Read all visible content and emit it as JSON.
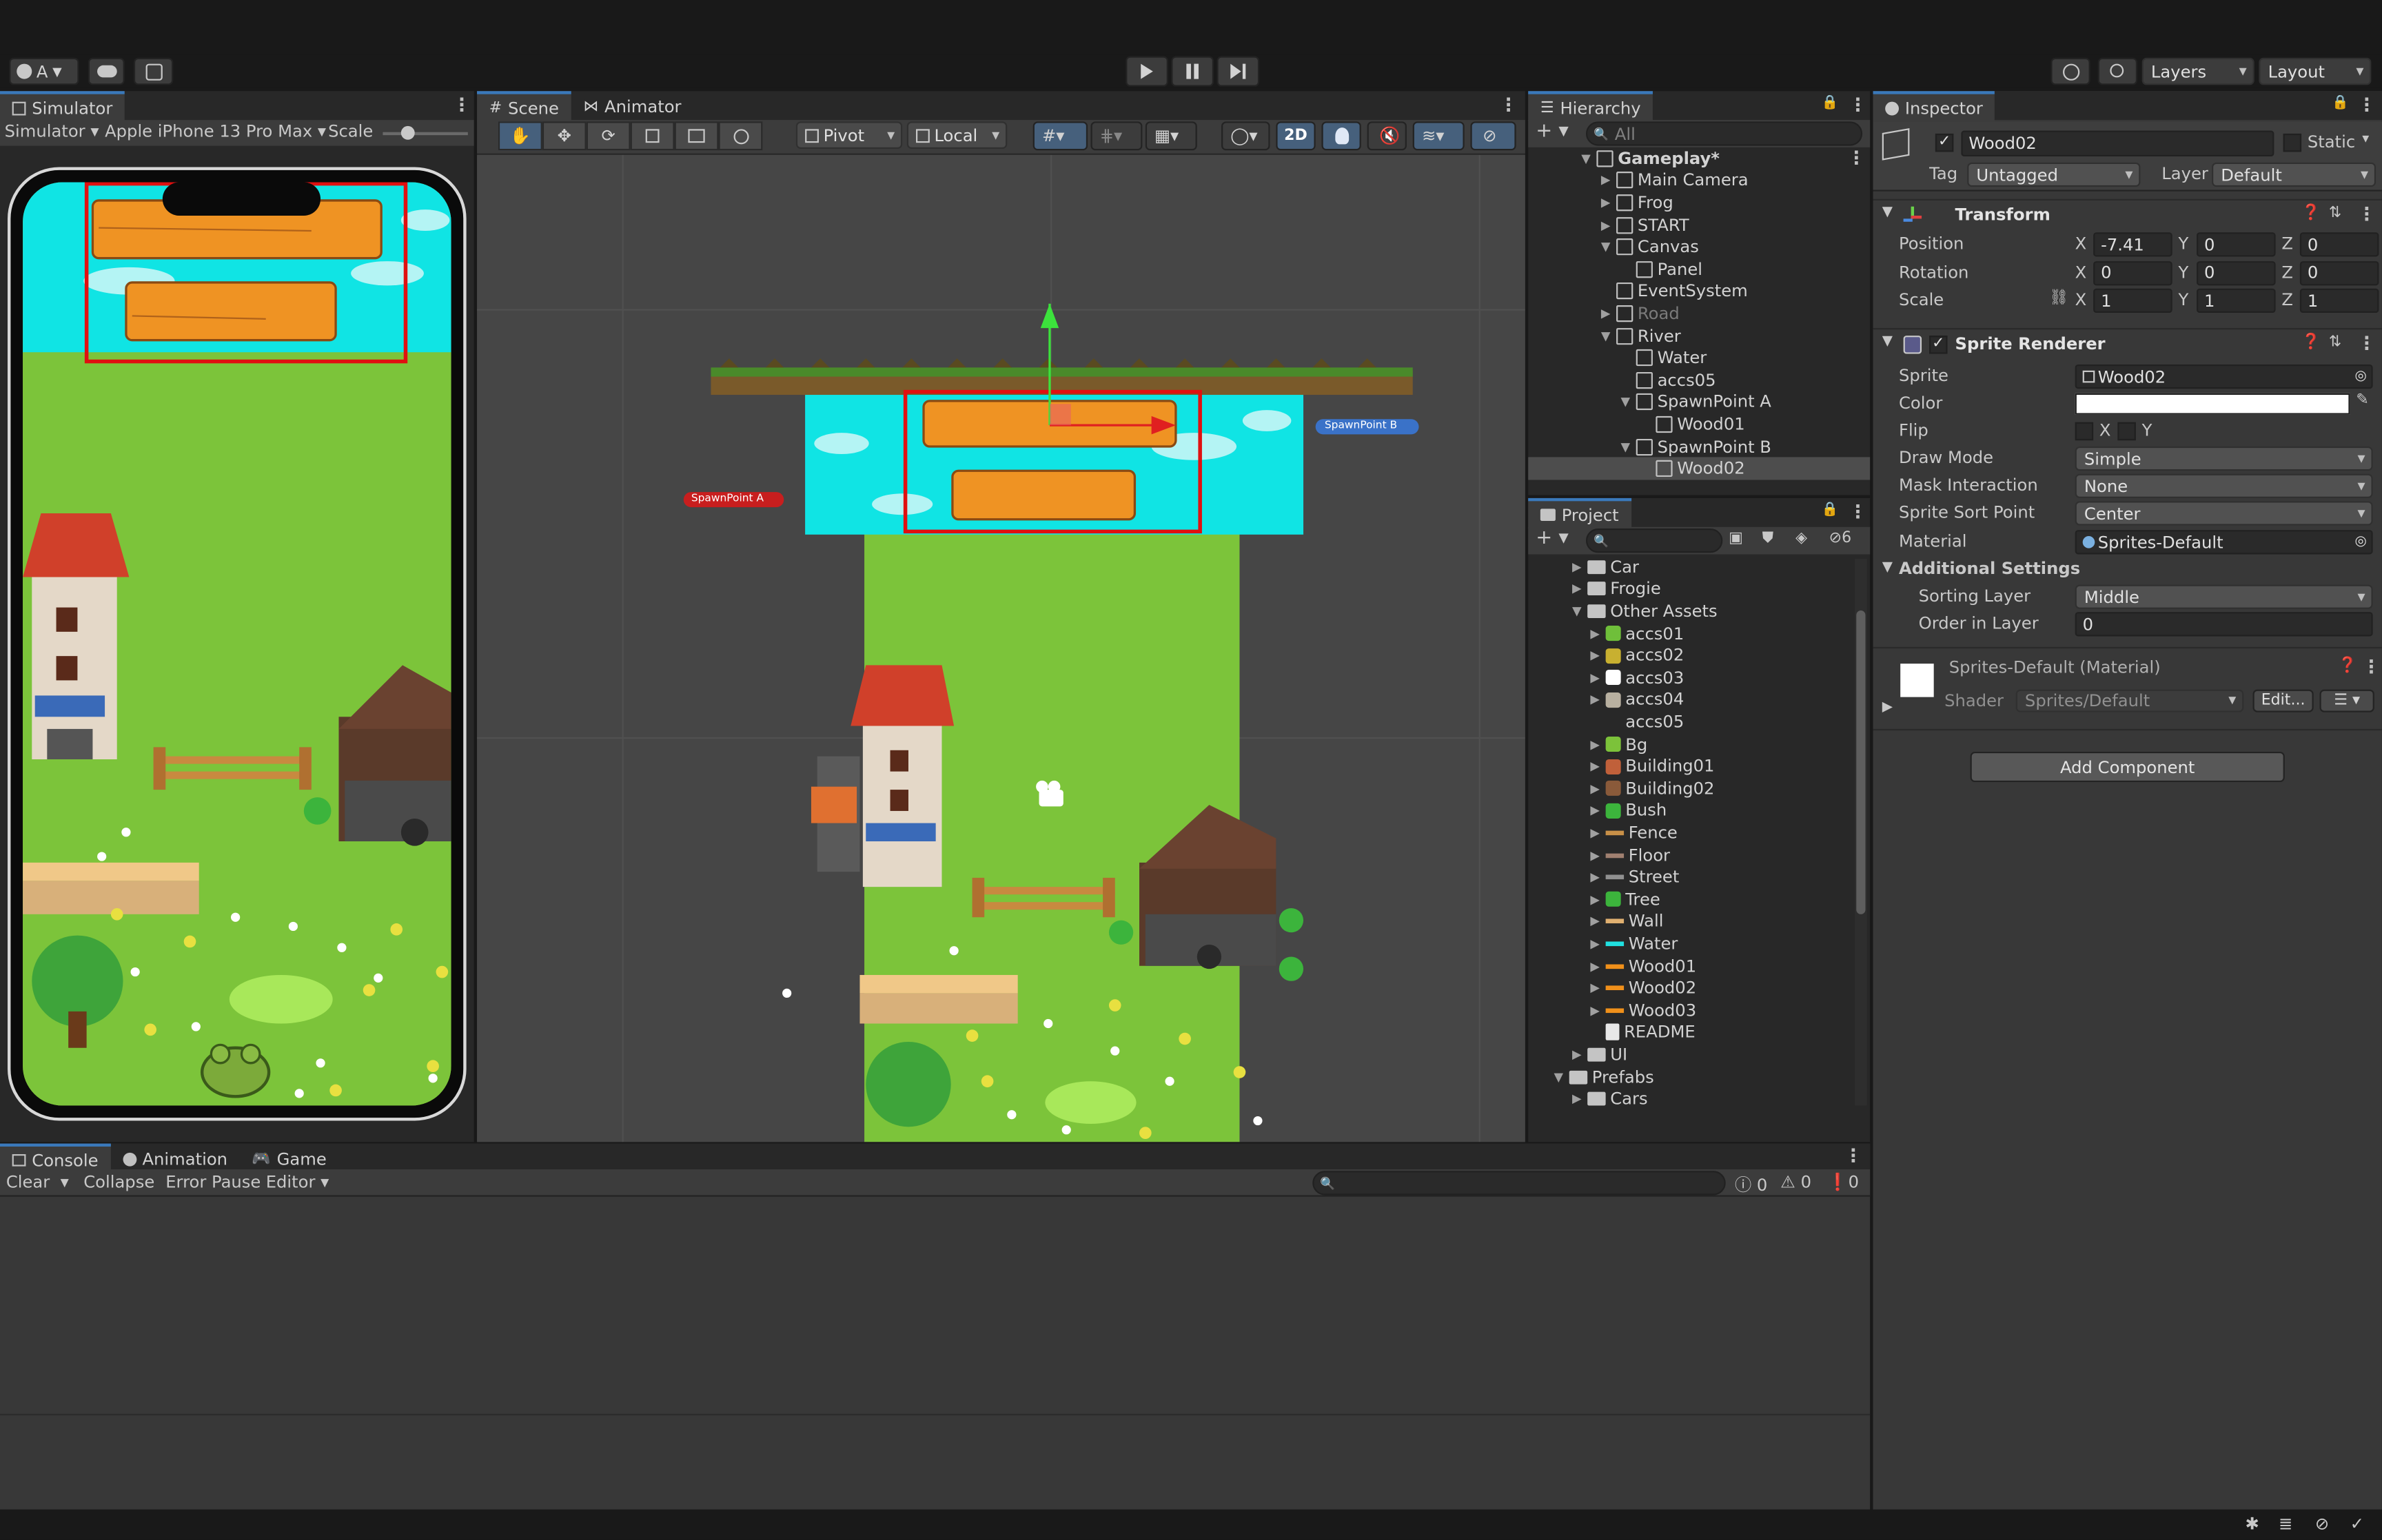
{
  "toolbar": {
    "account": "A",
    "layers": "Layers",
    "layout": "Layout"
  },
  "simulator": {
    "tab": "Simulator",
    "mode": "Simulator",
    "device": "Apple iPhone 13 Pro Max",
    "scale_label": "Scale"
  },
  "scene": {
    "tab_scene": "Scene",
    "tab_animator": "Animator",
    "pivot": "Pivot",
    "local": "Local",
    "mode_2d": "2D",
    "spawn_a": "SpawnPoint A",
    "spawn_b": "SpawnPoint B"
  },
  "hierarchy": {
    "title": "Hierarchy",
    "search": "All",
    "items": [
      {
        "label": "Gameplay*",
        "indent": 0,
        "arrow": "▼",
        "bold": true
      },
      {
        "label": "Main Camera",
        "indent": 1,
        "arrow": "▶"
      },
      {
        "label": "Frog",
        "indent": 1,
        "arrow": "▶"
      },
      {
        "label": "START",
        "indent": 1,
        "arrow": "▶"
      },
      {
        "label": "Canvas",
        "indent": 1,
        "arrow": "▼"
      },
      {
        "label": "Panel",
        "indent": 2,
        "arrow": ""
      },
      {
        "label": "EventSystem",
        "indent": 1,
        "arrow": ""
      },
      {
        "label": "Road",
        "indent": 1,
        "arrow": "▶",
        "dim": true
      },
      {
        "label": "River",
        "indent": 1,
        "arrow": "▼"
      },
      {
        "label": "Water",
        "indent": 2,
        "arrow": ""
      },
      {
        "label": "accs05",
        "indent": 2,
        "arrow": ""
      },
      {
        "label": "SpawnPoint A",
        "indent": 2,
        "arrow": "▼"
      },
      {
        "label": "Wood01",
        "indent": 3,
        "arrow": ""
      },
      {
        "label": "SpawnPoint B",
        "indent": 2,
        "arrow": "▼"
      },
      {
        "label": "Wood02",
        "indent": 3,
        "arrow": "",
        "selected": true
      }
    ]
  },
  "project": {
    "title": "Project",
    "hidden_count": "6",
    "items": [
      {
        "label": "Car",
        "indent": 0,
        "arrow": "▶",
        "icon": "folder"
      },
      {
        "label": "Frogie",
        "indent": 0,
        "arrow": "▶",
        "icon": "folder"
      },
      {
        "label": "Other Assets",
        "indent": 0,
        "arrow": "▼",
        "icon": "folder-open"
      },
      {
        "label": "accs01",
        "indent": 1,
        "arrow": "▶",
        "icon": "sprite",
        "color": "#6fbf3a"
      },
      {
        "label": "accs02",
        "indent": 1,
        "arrow": "▶",
        "icon": "sprite",
        "color": "#c8b030"
      },
      {
        "label": "accs03",
        "indent": 1,
        "arrow": "▶",
        "icon": "sprite",
        "color": "#ffffff"
      },
      {
        "label": "accs04",
        "indent": 1,
        "arrow": "▶",
        "icon": "sprite",
        "color": "#b8b0a0"
      },
      {
        "label": "accs05",
        "indent": 1,
        "arrow": "",
        "icon": "none"
      },
      {
        "label": "Bg",
        "indent": 1,
        "arrow": "▶",
        "icon": "sprite",
        "color": "#7cc23a"
      },
      {
        "label": "Building01",
        "indent": 1,
        "arrow": "▶",
        "icon": "sprite",
        "color": "#c0603a"
      },
      {
        "label": "Building02",
        "indent": 1,
        "arrow": "▶",
        "icon": "sprite",
        "color": "#8a5a3a"
      },
      {
        "label": "Bush",
        "indent": 1,
        "arrow": "▶",
        "icon": "sprite",
        "color": "#3cb43c"
      },
      {
        "label": "Fence",
        "indent": 1,
        "arrow": "▶",
        "icon": "line",
        "color": "#c89048"
      },
      {
        "label": "Floor",
        "indent": 1,
        "arrow": "▶",
        "icon": "line",
        "color": "#a08070"
      },
      {
        "label": "Street",
        "indent": 1,
        "arrow": "▶",
        "icon": "line",
        "color": "#909090"
      },
      {
        "label": "Tree",
        "indent": 1,
        "arrow": "▶",
        "icon": "sprite",
        "color": "#3cb43c"
      },
      {
        "label": "Wall",
        "indent": 1,
        "arrow": "▶",
        "icon": "line",
        "color": "#e0b070"
      },
      {
        "label": "Water",
        "indent": 1,
        "arrow": "▶",
        "icon": "line",
        "color": "#20e0e0"
      },
      {
        "label": "Wood01",
        "indent": 1,
        "arrow": "▶",
        "icon": "line",
        "color": "#f0901a"
      },
      {
        "label": "Wood02",
        "indent": 1,
        "arrow": "▶",
        "icon": "line",
        "color": "#f0901a"
      },
      {
        "label": "Wood03",
        "indent": 1,
        "arrow": "▶",
        "icon": "line",
        "color": "#f0901a"
      },
      {
        "label": "README",
        "indent": 1,
        "arrow": "",
        "icon": "doc"
      },
      {
        "label": "UI",
        "indent": 0,
        "arrow": "▶",
        "icon": "folder"
      },
      {
        "label": "Prefabs",
        "indent": -1,
        "arrow": "▼",
        "icon": "folder-open"
      },
      {
        "label": "Cars",
        "indent": 0,
        "arrow": "▶",
        "icon": "folder"
      }
    ]
  },
  "inspector": {
    "title": "Inspector",
    "object_name": "Wood02",
    "static": "Static",
    "tag_label": "Tag",
    "tag": "Untagged",
    "layer_label": "Layer",
    "layer": "Default",
    "transform": {
      "title": "Transform",
      "rows": [
        {
          "label": "Position",
          "x": "-7.41",
          "y": "0",
          "z": "0"
        },
        {
          "label": "Rotation",
          "x": "0",
          "y": "0",
          "z": "0"
        },
        {
          "label": "Scale",
          "x": "1",
          "y": "1",
          "z": "1"
        }
      ]
    },
    "axes": {
      "x": "X",
      "y": "Y",
      "z": "Z"
    },
    "sprite_renderer": {
      "title": "Sprite Renderer",
      "sprite_label": "Sprite",
      "sprite": "Wood02",
      "color_label": "Color",
      "flip_label": "Flip",
      "draw_mode_label": "Draw Mode",
      "draw_mode": "Simple",
      "mask_label": "Mask Interaction",
      "mask": "None",
      "sort_point_label": "Sprite Sort Point",
      "sort_point": "Center",
      "material_label": "Material",
      "material": "Sprites-Default",
      "additional": "Additional Settings",
      "sorting_layer_label": "Sorting Layer",
      "sorting_layer": "Middle",
      "order_label": "Order in Layer",
      "order": "0"
    },
    "material": {
      "title": "Sprites-Default (Material)",
      "shader_label": "Shader",
      "shader": "Sprites/Default",
      "edit": "Edit..."
    },
    "add_component": "Add Component"
  },
  "bottom": {
    "tab_console": "Console",
    "tab_animation": "Animation",
    "tab_game": "Game",
    "clear": "Clear",
    "collapse": "Collapse",
    "error_pause": "Error Pause",
    "editor": "Editor",
    "count_log": "0",
    "count_warn": "0",
    "count_err": "0"
  }
}
